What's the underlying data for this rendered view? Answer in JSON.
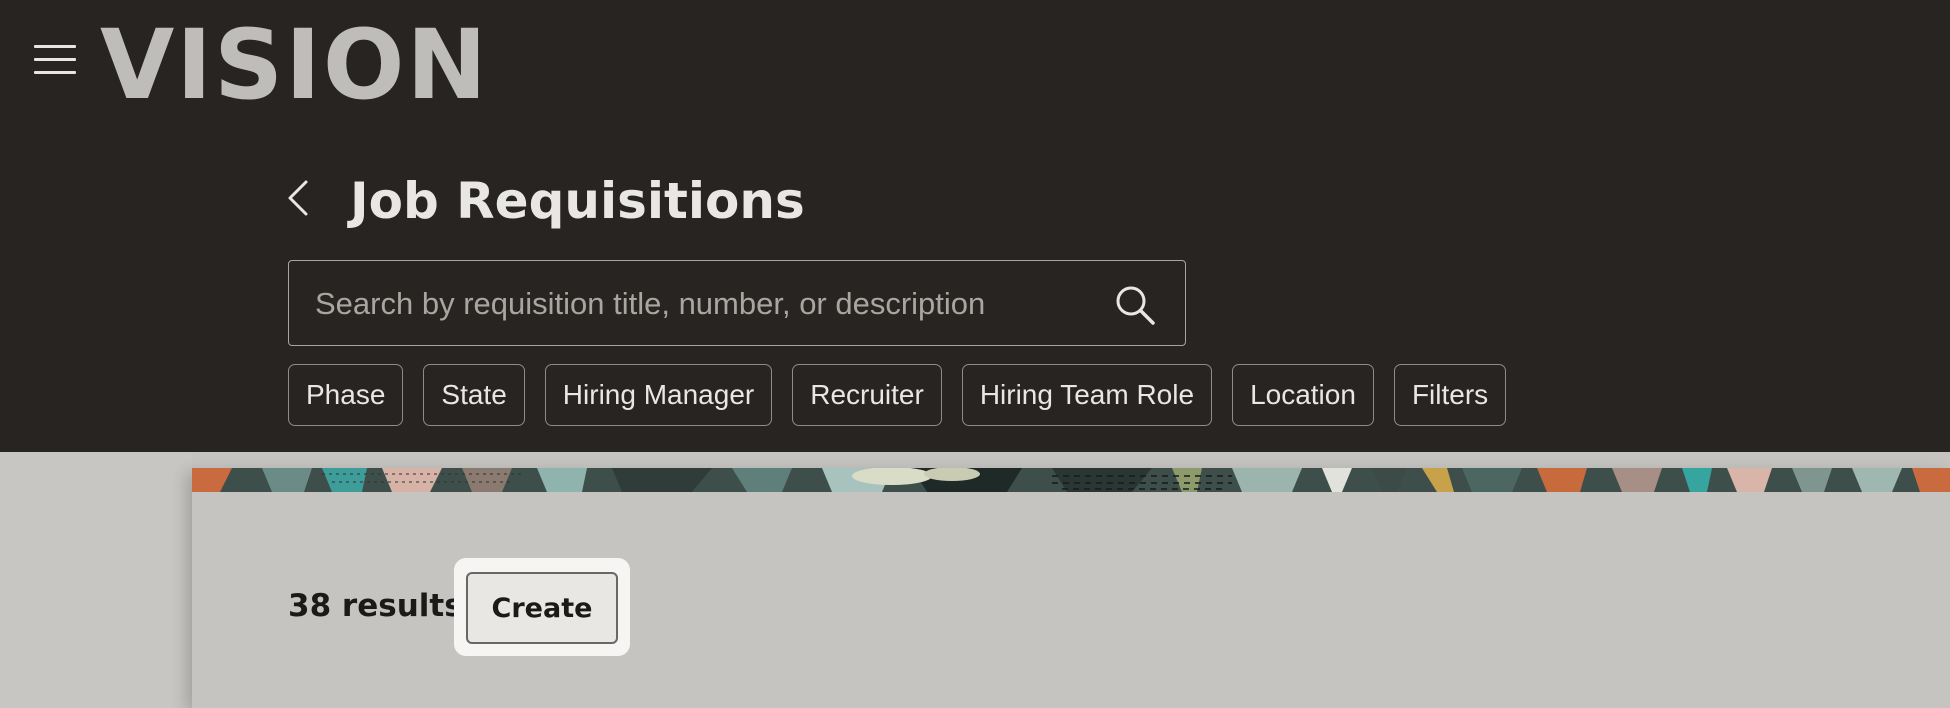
{
  "app": {
    "logo_text": "VISION"
  },
  "header": {
    "title": "Job Requisitions"
  },
  "search": {
    "placeholder": "Search by requisition title, number, or description",
    "value": ""
  },
  "filters": [
    {
      "label": "Phase"
    },
    {
      "label": "State"
    },
    {
      "label": "Hiring Manager"
    },
    {
      "label": "Recruiter"
    },
    {
      "label": "Hiring Team Role"
    },
    {
      "label": "Location"
    },
    {
      "label": "Filters"
    }
  ],
  "results": {
    "count_text": "38 results",
    "create_label": "Create"
  },
  "icons": {
    "menu": "hamburger-menu-icon",
    "back": "chevron-left-icon",
    "search": "search-icon"
  },
  "colors": {
    "header_bg": "#272421",
    "content_bg": "#c5c4c1",
    "text_light": "#e9e7e4",
    "text_dark": "#1c1a18"
  }
}
